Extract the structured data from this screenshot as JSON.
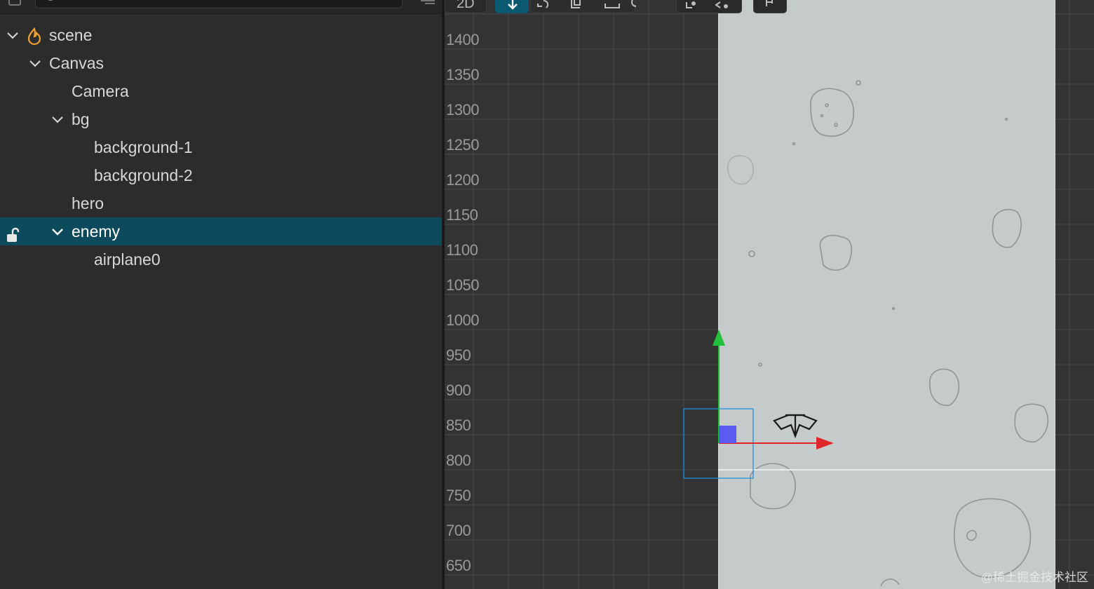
{
  "hierarchy": {
    "search": {
      "placeholder": ""
    },
    "nodes": [
      {
        "label": "scene",
        "level": 0,
        "expanded": true,
        "icon": "fire-icon"
      },
      {
        "label": "Canvas",
        "level": 1,
        "expanded": true
      },
      {
        "label": "Camera",
        "level": 2
      },
      {
        "label": "bg",
        "level": 2,
        "expanded": true
      },
      {
        "label": "background-1",
        "level": 3
      },
      {
        "label": "background-2",
        "level": 3
      },
      {
        "label": "hero",
        "level": 2
      },
      {
        "label": "enemy",
        "level": 2,
        "expanded": true,
        "selected": true,
        "icon": "unlock-icon"
      },
      {
        "label": "airplane0",
        "level": 3
      }
    ]
  },
  "scene_view": {
    "toolbar": {
      "mode_label": "2D"
    },
    "y_axis_labels": [
      "1400",
      "1350",
      "1300",
      "1250",
      "1200",
      "1150",
      "1100",
      "1050",
      "1000",
      "950",
      "900",
      "850",
      "800",
      "750",
      "700",
      "650"
    ],
    "colors": {
      "selection": "#0d4b5c",
      "gizmo_x": "#e0252b",
      "gizmo_y": "#22c03b",
      "gizmo_center": "#5a5cf0",
      "selection_box": "#1e8fdc"
    }
  },
  "watermark": "@稀土掘金技术社区"
}
